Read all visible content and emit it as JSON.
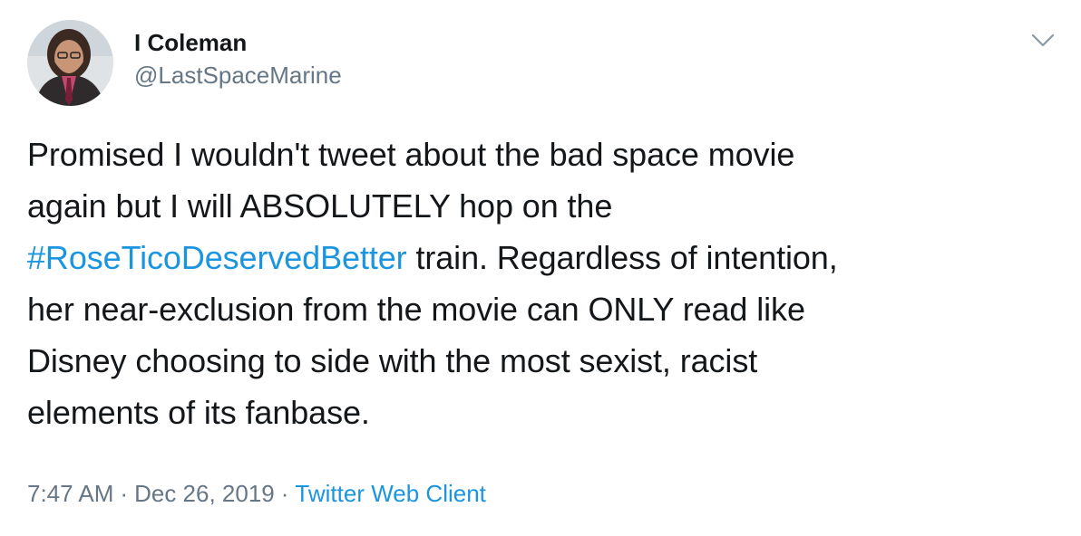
{
  "author": {
    "display_name": "I Coleman",
    "handle": "@LastSpaceMarine",
    "avatar_icon": "profile-photo"
  },
  "menu": {
    "icon": "chevron-down-icon"
  },
  "tweet": {
    "line1": "Promised I wouldn't tweet about the bad space movie",
    "line2": "again but I will ABSOLUTELY hop on the",
    "line3_hashtag": "#RoseTicoDeservedBetter",
    "line3_rest": " train. Regardless of intention,",
    "line4": "her near-exclusion from the movie can ONLY read like",
    "line5": "Disney choosing to side with the most sexist, racist",
    "line6": "elements of its fanbase."
  },
  "meta": {
    "time": "7:47 AM",
    "separator": "·",
    "date": "Dec 26, 2019",
    "source": "Twitter Web Client"
  },
  "colors": {
    "text": "#14171a",
    "secondary": "#657786",
    "link": "#1b95e0",
    "background": "#ffffff"
  }
}
